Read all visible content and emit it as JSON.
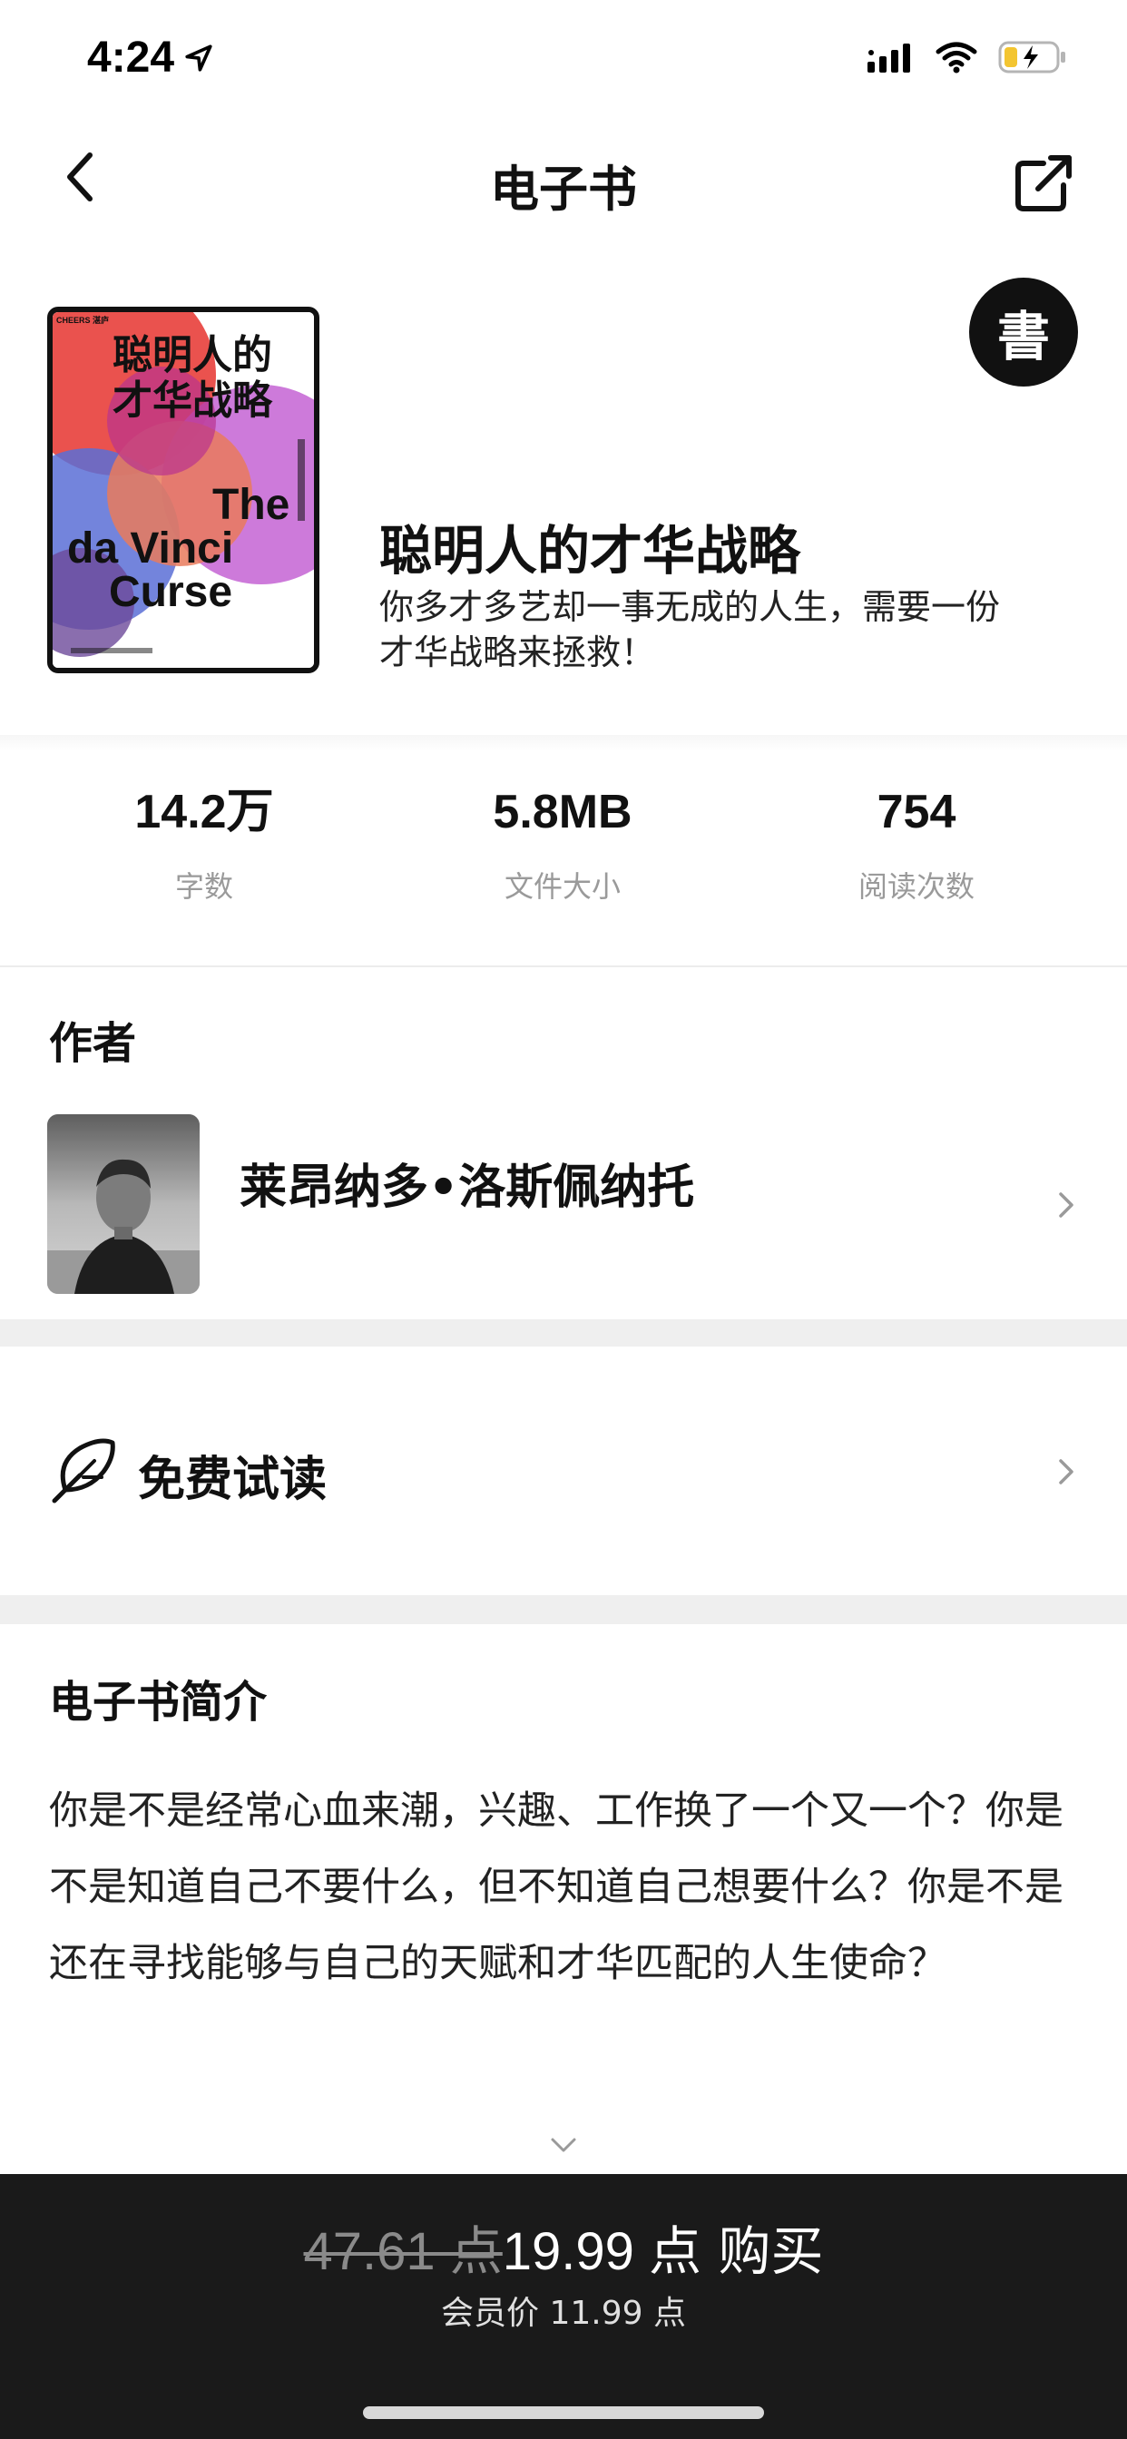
{
  "status": {
    "time": "4:24",
    "icons": [
      "location-arrow-icon",
      "cellular-signal-icon",
      "wifi-icon",
      "battery-charging-icon"
    ]
  },
  "nav": {
    "title": "电子书",
    "back_icon": "chevron-left-icon",
    "share_icon": "share-icon"
  },
  "book": {
    "title": "聪明人的才华战略",
    "description": "你多才多艺却一事无成的人生，需要一份才华战略来拯救！",
    "badge": "書",
    "cover": {
      "publisher_mark": "CHEERS 湛庐",
      "zh_title_line1": "聪明人的",
      "zh_title_line2": "才华战略",
      "en_title_line1": "The",
      "en_title_line2": "da Vinci",
      "en_title_line3": "Curse",
      "colors": [
        "#e8433f",
        "#b9338f",
        "#5a6fd6",
        "#e97a5c",
        "#c86bd6"
      ]
    }
  },
  "stats": [
    {
      "value": "14.2万",
      "label": "字数"
    },
    {
      "value": "5.8MB",
      "label": "文件大小"
    },
    {
      "value": "754",
      "label": "阅读次数"
    }
  ],
  "author": {
    "section_title": "作者",
    "name": "莱昂纳多•洛斯佩纳托"
  },
  "trial": {
    "label": "免费试读",
    "icon": "feather-icon"
  },
  "intro": {
    "section_title": "电子书简介",
    "text": "你是不是经常心血来潮，兴趣、工作换了一个又一个？你是不是知道自己不要什么，但不知道自己想要什么？你是不是还在寻找能够与自己的天赋和才华匹配的人生使命？"
  },
  "buy": {
    "original_price": "47.61 点",
    "price": "19.99 点",
    "action": "购买",
    "member_price": "会员价 11.99 点"
  }
}
